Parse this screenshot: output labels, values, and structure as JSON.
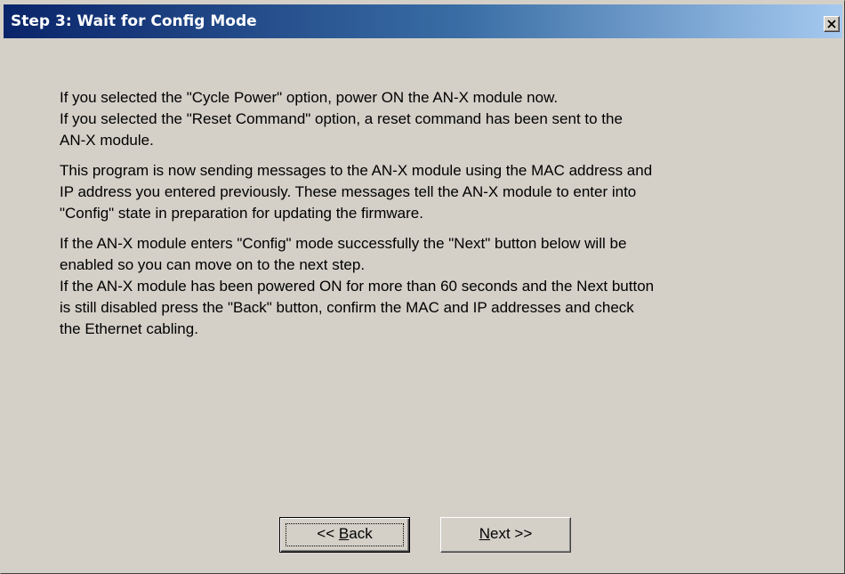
{
  "window": {
    "title": "Step 3: Wait for Config Mode",
    "close_icon": "close-icon"
  },
  "paragraphs": [
    {
      "lines": [
        "If you selected the \"Cycle Power\" option, power ON the AN-X module now.",
        "If you selected the \"Reset Command\" option, a reset command has been sent to the",
        "AN-X module."
      ]
    },
    {
      "lines": [
        "This program is now sending messages to the AN-X module using the MAC address and",
        "IP address you entered previously. These messages tell the AN-X module to enter into",
        "\"Config\" state in preparation for updating the firmware."
      ]
    },
    {
      "lines": [
        "If the AN-X module enters \"Config\" mode successfully the \"Next\" button below will be",
        "enabled so you can move on to the next step.",
        "If the AN-X module has been powered ON for more than 60 seconds and the Next button",
        "is still disabled press the \"Back\" button, confirm the MAC and IP addresses and check",
        "the Ethernet cabling."
      ]
    }
  ],
  "buttons": {
    "back": {
      "prefix": "<< ",
      "accel": "B",
      "rest": "ack"
    },
    "next": {
      "accel": "N",
      "rest": "ext >>"
    }
  }
}
